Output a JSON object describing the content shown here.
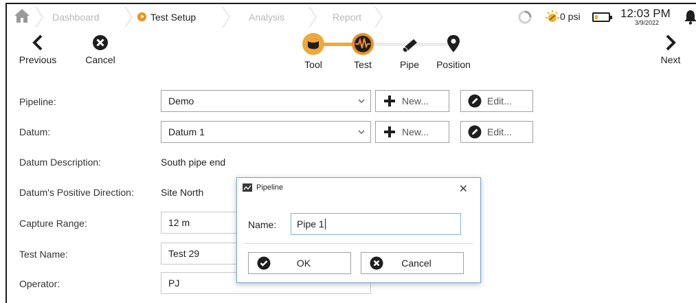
{
  "breadcrumb": {
    "items": [
      {
        "label": "Dashboard",
        "state": "inactive"
      },
      {
        "label": "Test Setup",
        "state": "active"
      },
      {
        "label": "Analysis",
        "state": "inactive"
      },
      {
        "label": "Report",
        "state": "inactive"
      }
    ]
  },
  "status": {
    "pressure": "0 psi",
    "time": "12:03 PM",
    "date": "3/9/2022",
    "battery_level": 0.2
  },
  "toolbar": {
    "previous_label": "Previous",
    "cancel_label": "Cancel",
    "next_label": "Next",
    "steps": [
      {
        "label": "Tool",
        "state": "done",
        "icon": "tool-icon"
      },
      {
        "label": "Test",
        "state": "current",
        "icon": "waveform-icon"
      },
      {
        "label": "Pipe",
        "state": "todo",
        "icon": "pipe-icon"
      },
      {
        "label": "Position",
        "state": "todo",
        "icon": "location-pin-icon"
      }
    ]
  },
  "form": {
    "pipeline": {
      "label": "Pipeline:",
      "value": "Demo",
      "new_label": "New...",
      "edit_label": "Edit..."
    },
    "datum": {
      "label": "Datum:",
      "value": "Datum 1",
      "new_label": "New...",
      "edit_label": "Edit..."
    },
    "datum_description": {
      "label": "Datum Description:",
      "value": "South pipe end"
    },
    "datum_direction": {
      "label": "Datum's Positive Direction:",
      "value": "Site North"
    },
    "capture_range": {
      "label": "Capture Range:",
      "value": "12 m"
    },
    "test_name": {
      "label": "Test Name:",
      "value": "Test 29"
    },
    "operator": {
      "label": "Operator:",
      "value": "PJ"
    }
  },
  "dialog": {
    "title": "Pipeline",
    "close_glyph": "✕",
    "name_label": "Name:",
    "name_value": "Pipe 1",
    "ok_label": "OK",
    "cancel_label": "Cancel"
  },
  "colors": {
    "accent": "#f0901e",
    "step_done": "#f0a838",
    "dialog_border": "#6aa6d8"
  }
}
